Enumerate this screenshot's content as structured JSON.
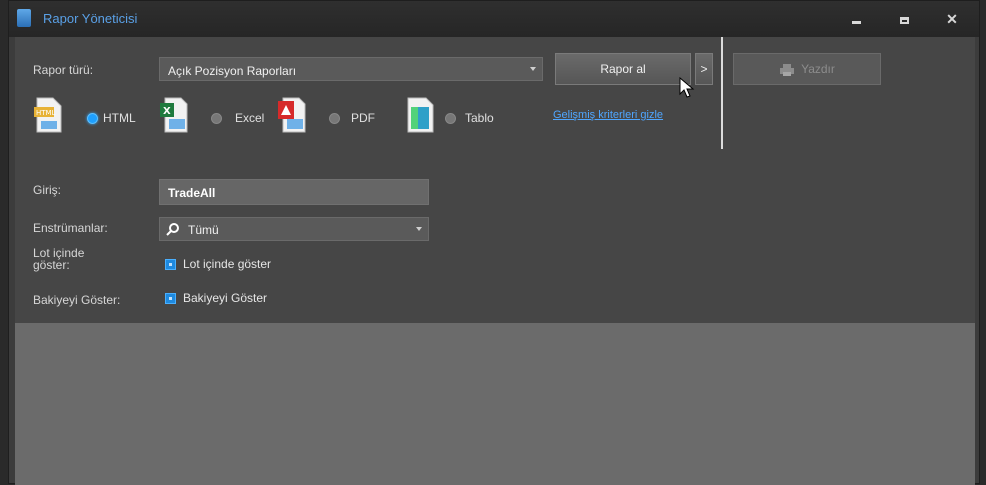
{
  "window": {
    "title": "Rapor Yöneticisi"
  },
  "report": {
    "type_label": "Rapor türü:",
    "type_value": "Açık Pozisyon Raporları",
    "get_report_label": "Rapor al",
    "more_label": ">",
    "print_label": "Yazdır"
  },
  "formats": [
    {
      "label": "HTML",
      "selected": true
    },
    {
      "label": "Excel",
      "selected": false
    },
    {
      "label": "PDF",
      "selected": false
    },
    {
      "label": "Tablo",
      "selected": false
    }
  ],
  "advanced_link": "Gelişmiş kriterleri gizle",
  "criteria": {
    "login_label": "Giriş:",
    "login_value": "TradeAll",
    "instruments_label": "Enstrümanlar:",
    "instruments_value": "Tümü",
    "lot_label_line1": "Lot içinde",
    "lot_label_line2": "göster:",
    "lot_checkbox_label": "Lot içinde göster",
    "balance_label": "Bakiyeyi Göster:",
    "balance_checkbox_label": "Bakiyeyi Göster"
  },
  "colors": {
    "accent": "#1ea0ff",
    "title": "#5aa0e6",
    "link": "#4fa6ff"
  },
  "icons": [
    "app-icon",
    "minimize-icon",
    "maximize-icon",
    "close-icon",
    "html-file-icon",
    "excel-file-icon",
    "pdf-file-icon",
    "table-file-icon",
    "printer-icon",
    "search-icon",
    "mouse-cursor-icon"
  ]
}
